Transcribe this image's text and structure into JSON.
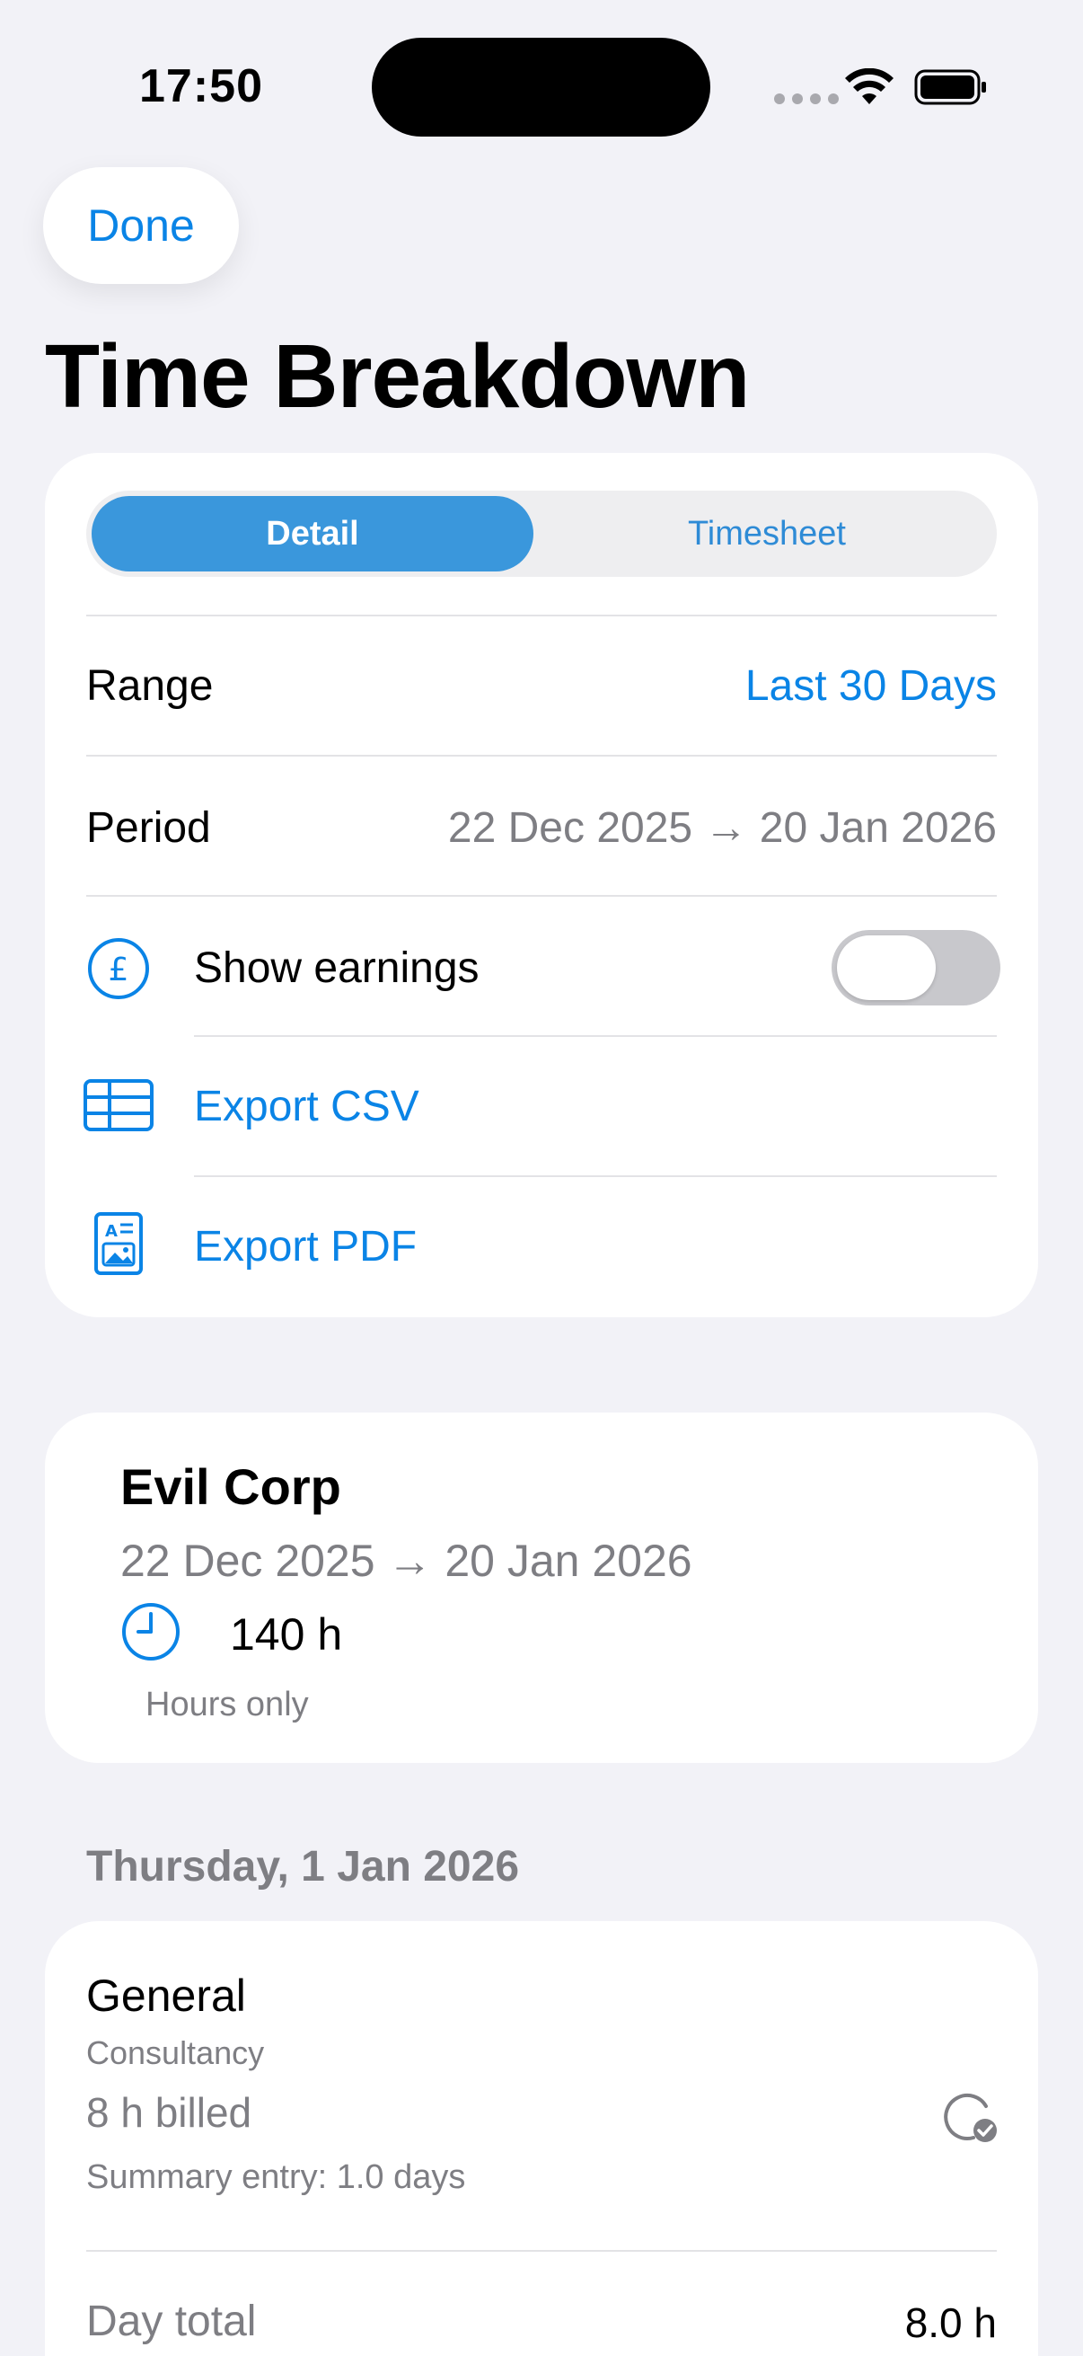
{
  "status_bar": {
    "time": "17:50"
  },
  "nav": {
    "done_label": "Done",
    "title": "Time Breakdown"
  },
  "controls": {
    "tabs": [
      {
        "label": "Detail",
        "selected": true
      },
      {
        "label": "Timesheet",
        "selected": false
      }
    ],
    "range_label": "Range",
    "range_value": "Last 30 Days",
    "period_label": "Period",
    "period_value": "22 Dec 2025 → 20 Jan 2026",
    "show_earnings_label": "Show earnings",
    "show_earnings_on": false,
    "export_csv_label": "Export CSV",
    "export_pdf_label": "Export PDF"
  },
  "summary": {
    "client_name": "Evil Corp",
    "period": "22 Dec 2025 → 20 Jan 2026",
    "hours": "140 h",
    "note": "Hours only"
  },
  "days": [
    {
      "heading": "Thursday, 1 Jan 2026",
      "entries": [
        {
          "title": "General",
          "category": "Consultancy",
          "billed": "8 h billed",
          "summary": "Summary entry: 1.0 days"
        }
      ],
      "total_label": "Day total",
      "total_value": "8.0 h"
    }
  ],
  "colors": {
    "accent": "#0A84E6",
    "segment_active": "#3A97DC",
    "background": "#F2F2F7",
    "secondary_text": "#7E7E83"
  },
  "icons": {
    "earnings": "pound-circle-icon",
    "csv": "table-icon",
    "pdf": "document-image-icon",
    "hours": "clock-icon",
    "status": "check-clock-icon"
  }
}
